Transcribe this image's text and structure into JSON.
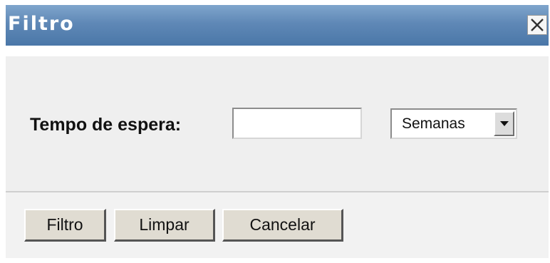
{
  "dialog": {
    "title": "Filtro",
    "close_icon": "close-x-icon"
  },
  "form": {
    "wait_time_label": "Tempo de espera:",
    "wait_time_value": "",
    "unit_selected": "Semanas",
    "unit_dropdown_icon": "triangle-down-icon"
  },
  "buttons": {
    "filter_label": "Filtro",
    "clear_label": "Limpar",
    "cancel_label": "Cancelar"
  },
  "colors": {
    "titlebar": "#5f88b6",
    "title_text": "#ffffff",
    "content_bg": "#efefef",
    "button_face": "#e0dcd2"
  }
}
